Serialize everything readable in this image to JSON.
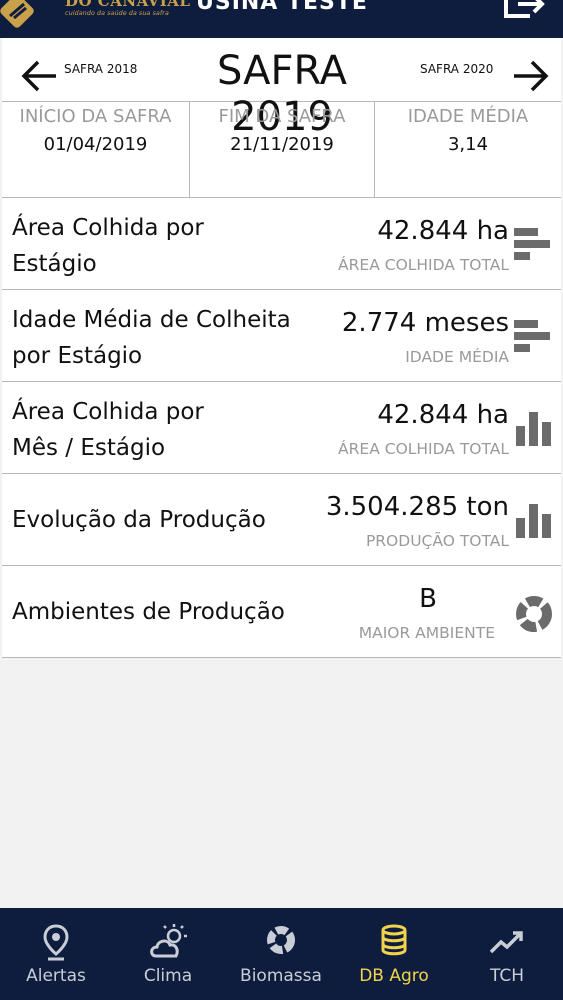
{
  "header": {
    "brand": "DO CANAVIAL",
    "brand_tagline": "cuidando da saúde da sua safra",
    "app_title": "USINA TESTE"
  },
  "season": {
    "prev_label": "SAFRA 2018",
    "title": "SAFRA 2019",
    "next_label": "SAFRA 2020"
  },
  "stats": [
    {
      "label": "INÍCIO DA SAFRA",
      "value": "01/04/2019"
    },
    {
      "label": "FIM DA SAFRA",
      "value": "21/11/2019"
    },
    {
      "label": "IDADE MÉDIA",
      "value": "3,14"
    }
  ],
  "rows": [
    {
      "title_line1": "Área Colhida por",
      "title_line2": "Estágio",
      "value": "42.844 ha",
      "caption": "ÁREA COLHIDA TOTAL",
      "icon": "horizontal-bar-chart-icon"
    },
    {
      "title_line1": "Idade Média de Colheita",
      "title_line2": "por Estágio",
      "value": "2.774 meses",
      "caption": "IDADE MÉDIA",
      "icon": "horizontal-bar-chart-icon"
    },
    {
      "title_line1": "Área Colhida por",
      "title_line2": "Mês / Estágio",
      "value": "42.844 ha",
      "caption": "ÁREA COLHIDA TOTAL",
      "icon": "vertical-bar-chart-icon"
    },
    {
      "title_line1": "Evolução da Produção",
      "value": "3.504.285 ton",
      "caption": "PRODUÇÃO TOTAL",
      "icon": "vertical-bar-chart-icon"
    },
    {
      "title_line1": "Ambientes de Produção",
      "value": "B",
      "caption": "MAIOR AMBIENTE",
      "icon": "pie-chart-icon"
    }
  ],
  "nav": [
    {
      "label": "Alertas",
      "icon": "location-pin-icon"
    },
    {
      "label": "Clima",
      "icon": "cloud-sun-icon"
    },
    {
      "label": "Biomassa",
      "icon": "pie-chart-icon"
    },
    {
      "label": "DB Agro",
      "icon": "database-icon",
      "active": true
    },
    {
      "label": "TCH",
      "icon": "trend-line-icon"
    }
  ],
  "colors": {
    "navy": "#0e1d3e",
    "gold": "#c9a14a",
    "active": "#f2d34b",
    "muted": "#9a9a9a"
  }
}
